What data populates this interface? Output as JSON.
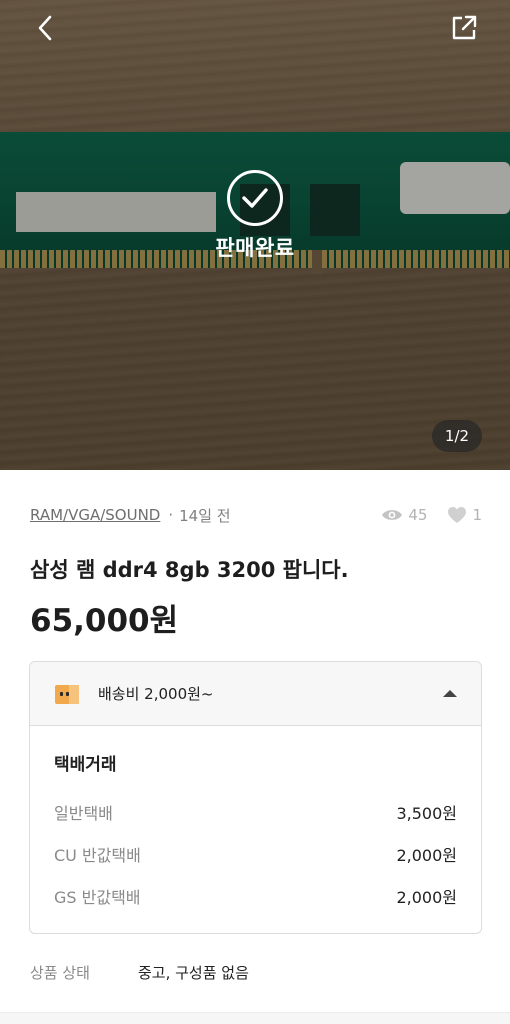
{
  "hero": {
    "status_label": "판매완료",
    "image_counter": "1/2",
    "back_icon": "chevron-left-icon",
    "share_icon": "share-icon"
  },
  "product": {
    "category": "RAM/VGA/SOUND",
    "separator": "·",
    "posted_ago": "14일 전",
    "views": "45",
    "likes": "1",
    "title": "삼성 램 ddr4 8gb 3200 팝니다.",
    "price": "65,000원"
  },
  "shipping": {
    "fee_summary": "배송비 2,000원~",
    "method": "택배거래",
    "options": [
      {
        "name": "일반택배",
        "cost": "3,500원"
      },
      {
        "name": "CU 반값택배",
        "cost": "2,000원"
      },
      {
        "name": "GS 반값택배",
        "cost": "2,000원"
      }
    ]
  },
  "condition": {
    "label": "상품 상태",
    "value": "중고, 구성품 없음"
  },
  "colors": {
    "text": "#1e1e1e",
    "muted": "#8a8a8a",
    "border": "#dcdcdc",
    "box_icon": "#f2a94e"
  }
}
